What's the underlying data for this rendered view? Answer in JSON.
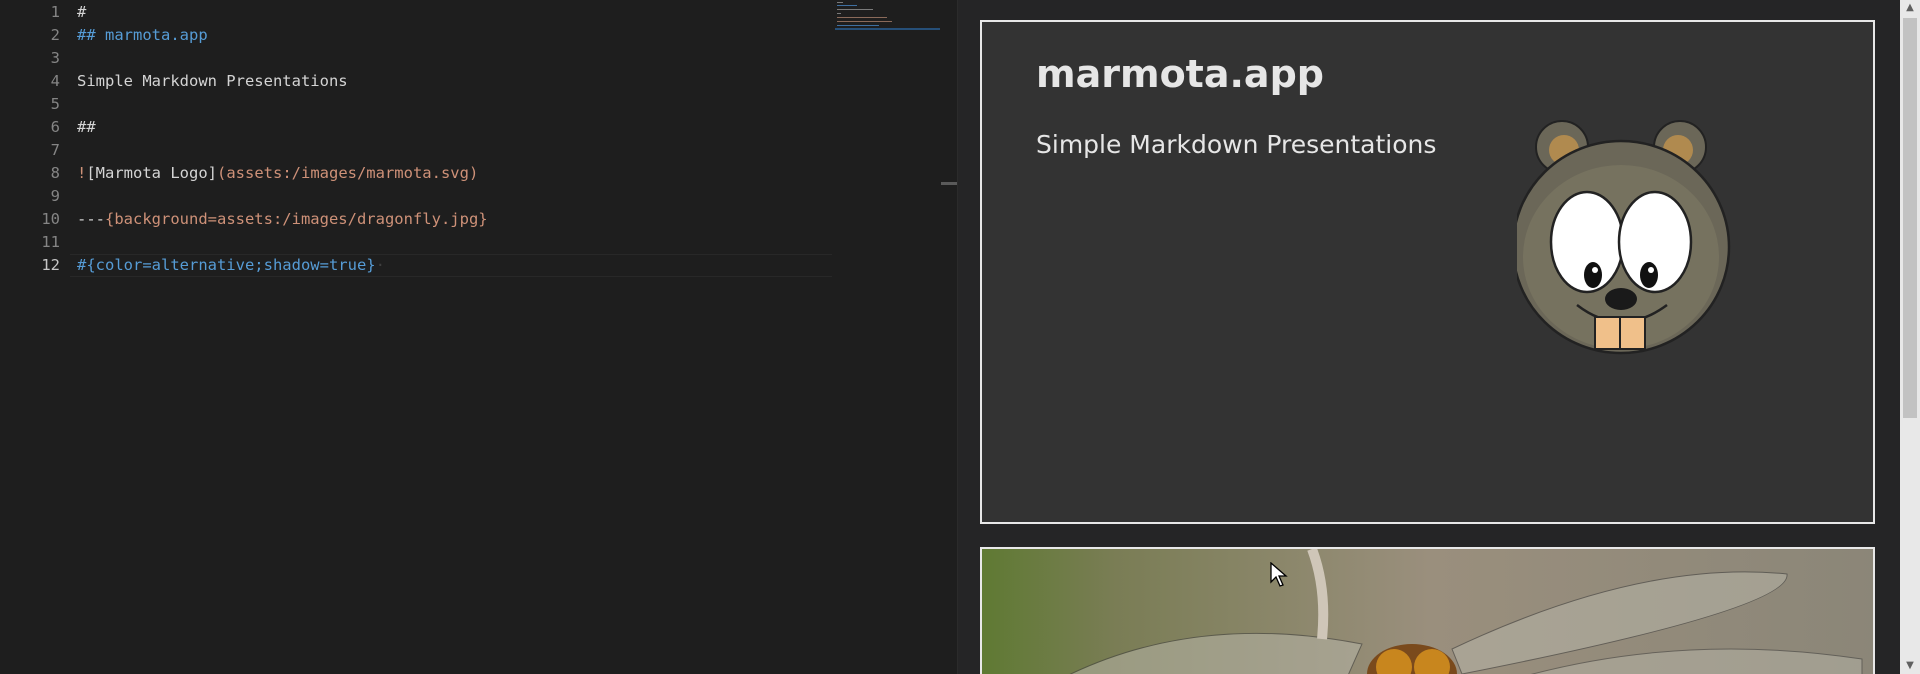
{
  "editor": {
    "line_numbers": [
      "1",
      "2",
      "3",
      "4",
      "5",
      "6",
      "7",
      "8",
      "9",
      "10",
      "11",
      "12"
    ],
    "active_line": "12",
    "lines": {
      "l1": "#",
      "l2": "## marmota.app",
      "l4": "Simple Markdown Presentations",
      "l6": "##",
      "l8_bang": "!",
      "l8_alt": "[Marmota Logo]",
      "l8_src": "(assets:/images/marmota.svg)",
      "l10_sep": "---",
      "l10_attr": "{background=assets:/images/dragonfly.jpg}",
      "l12": "#{color=alternative;shadow=true}",
      "l12_ws": "·"
    }
  },
  "preview": {
    "slide1": {
      "title": "marmota.app",
      "subtitle": "Simple Markdown Presentations",
      "logo_icon": "marmota-logo"
    },
    "slide2": {
      "background_icon": "dragonfly-photo"
    }
  },
  "colors": {
    "editor_bg": "#1e1e1e",
    "heading": "#569cd6",
    "string": "#ce9178",
    "slide_bg": "#333333"
  }
}
